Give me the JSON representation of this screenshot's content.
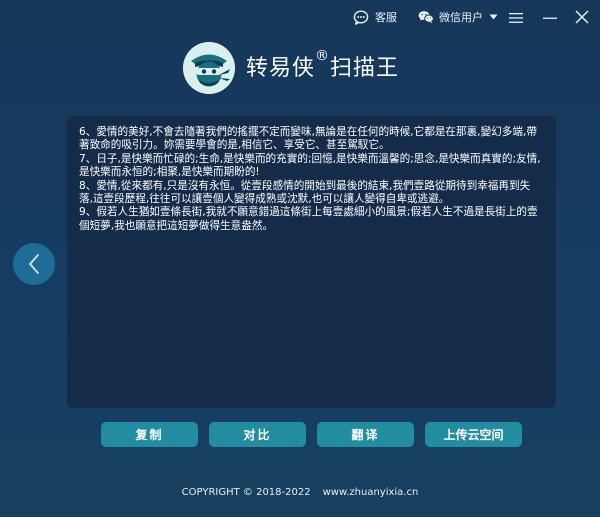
{
  "topbar": {
    "service_label": "客服",
    "wechat_user_label": "微信用户"
  },
  "app": {
    "title": "转易侠",
    "reg_mark": "®",
    "title_suffix": "扫描王"
  },
  "content": {
    "text": "6、愛情的美好,不會去隨著我們的搖擺不定而變味,無論是在任何的時候,它都是在那裏,變幻多端,帶著致命的吸引力。妳需要學會的是,相信它、享受它、甚至駕馭它。\n7、日子,是快樂而忙碌的;生命,是快樂而的充實的;回憶,是快樂而溫馨的;思念,是快樂而真實的;友情,是快樂而永恒的;相聚,是快樂而期盼的!\n8、愛情,從來都有,只是沒有永恒。從壹段感情的開始到最後的結束,我們壹路從期待到幸福再到失落,這壹段歷程,往往可以讓壹個人變得成熟或沈默,也可以讓人變得自卑或逃避。\n9、假若人生猶如壹條長街,我就不願意錯過這條街上每壹處細小的風景;假若人生不過是長街上的壹個短夢,我也願意把這短夢做得生意盎然。"
  },
  "actions": {
    "copy": "复制",
    "compare": "对比",
    "translate": "翻译",
    "upload": "上传云空间"
  },
  "footer": {
    "copyright": "COPYRIGHT © 2018-2022",
    "website": "www.zhuanyixia.cn"
  },
  "colors": {
    "background": "#163c62",
    "panel": "#142c4a",
    "button": "#228ca0",
    "nav_button": "#1f6d97",
    "logo_bg": "#d9f0ee"
  },
  "icons": {
    "service": "chat-bubble-icon",
    "wechat": "wechat-icon",
    "menu": "hamburger-menu-icon",
    "minimize": "minimize-icon",
    "close": "close-icon",
    "nav_left": "chevron-left-icon"
  }
}
